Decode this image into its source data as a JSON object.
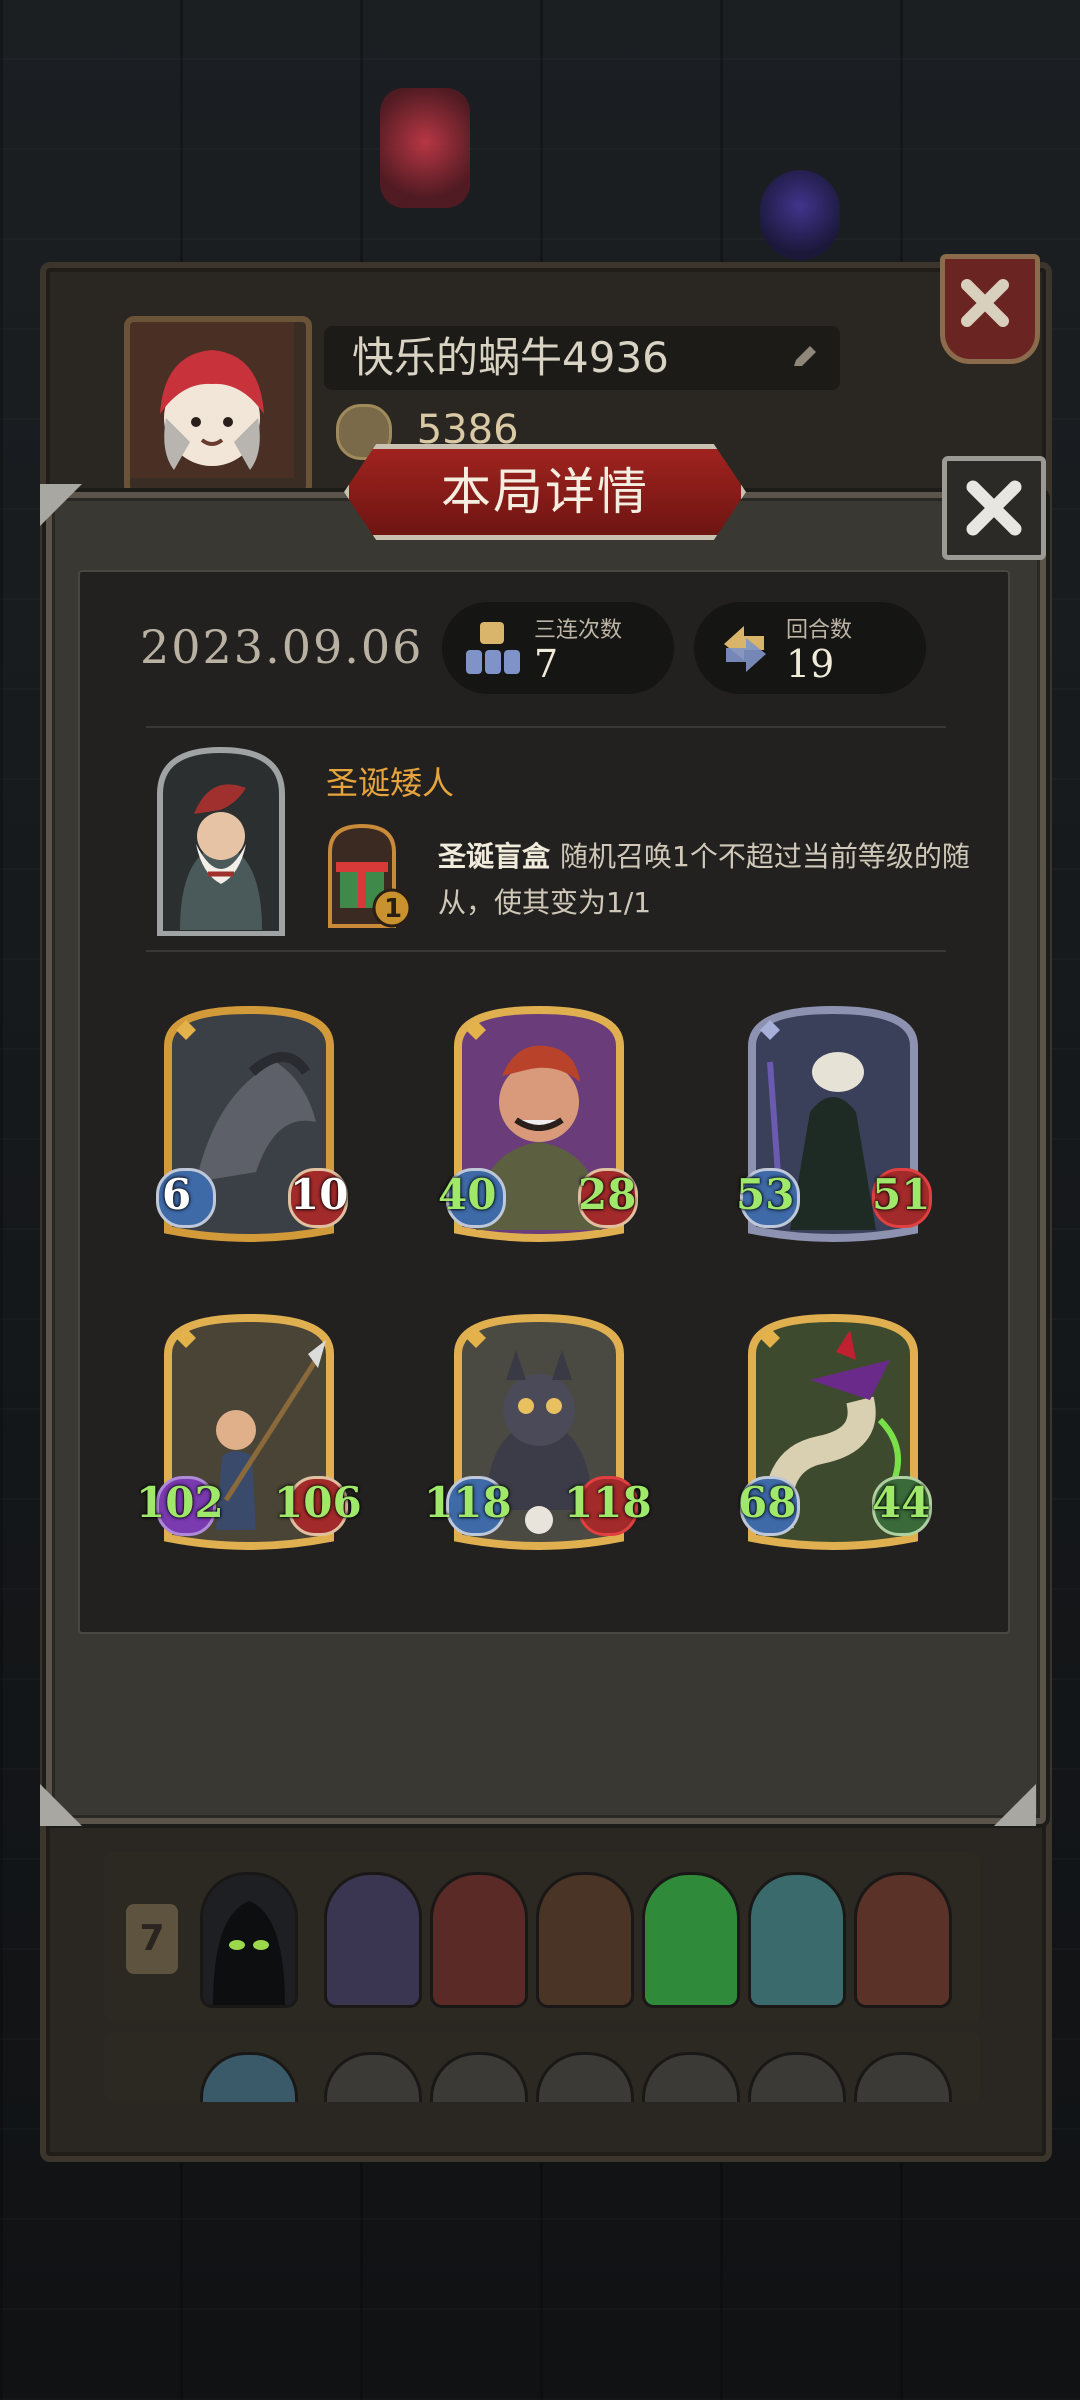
{
  "profile": {
    "player_name": "快乐的蜗牛4936",
    "coins": "5386"
  },
  "dialog": {
    "title": "本局详情",
    "date": "2023.09.06",
    "triples": {
      "label": "三连次数",
      "value": "7"
    },
    "rounds": {
      "label": "回合数",
      "value": "19"
    }
  },
  "hero": {
    "name": "圣诞矮人",
    "skill_name": "圣诞盲盒",
    "skill_text": "随机召唤1个不超过当前等级的随从，使其变为1/1",
    "skill_level": "1"
  },
  "cards": [
    {
      "attack": "6",
      "health": "10",
      "frame": "gold",
      "attack_color": "#ffffff",
      "health_color": "#ffffff"
    },
    {
      "attack": "40",
      "health": "28",
      "frame": "gold-glow",
      "attack_color": "#9fe86a",
      "health_color": "#9fe86a"
    },
    {
      "attack": "53",
      "health": "51",
      "frame": "silver",
      "attack_color": "#9fe86a",
      "health_color": "#9fe86a"
    },
    {
      "attack": "102",
      "health": "106",
      "frame": "gold-glow",
      "attack_color": "#9fe86a",
      "health_color": "#9fe86a"
    },
    {
      "attack": "118",
      "health": "118",
      "frame": "gold-glow",
      "attack_color": "#9fe86a",
      "health_color": "#9fe86a"
    },
    {
      "attack": "68",
      "health": "44",
      "frame": "gold",
      "attack_color": "#9fe86a",
      "health_color": "#9fe86a"
    }
  ],
  "history": {
    "row1_round": "7"
  },
  "colors": {
    "accent_red": "#a0231f",
    "gold": "#d9a441",
    "hero_name": "#e6a43c",
    "buff_green": "#9fe86a"
  }
}
